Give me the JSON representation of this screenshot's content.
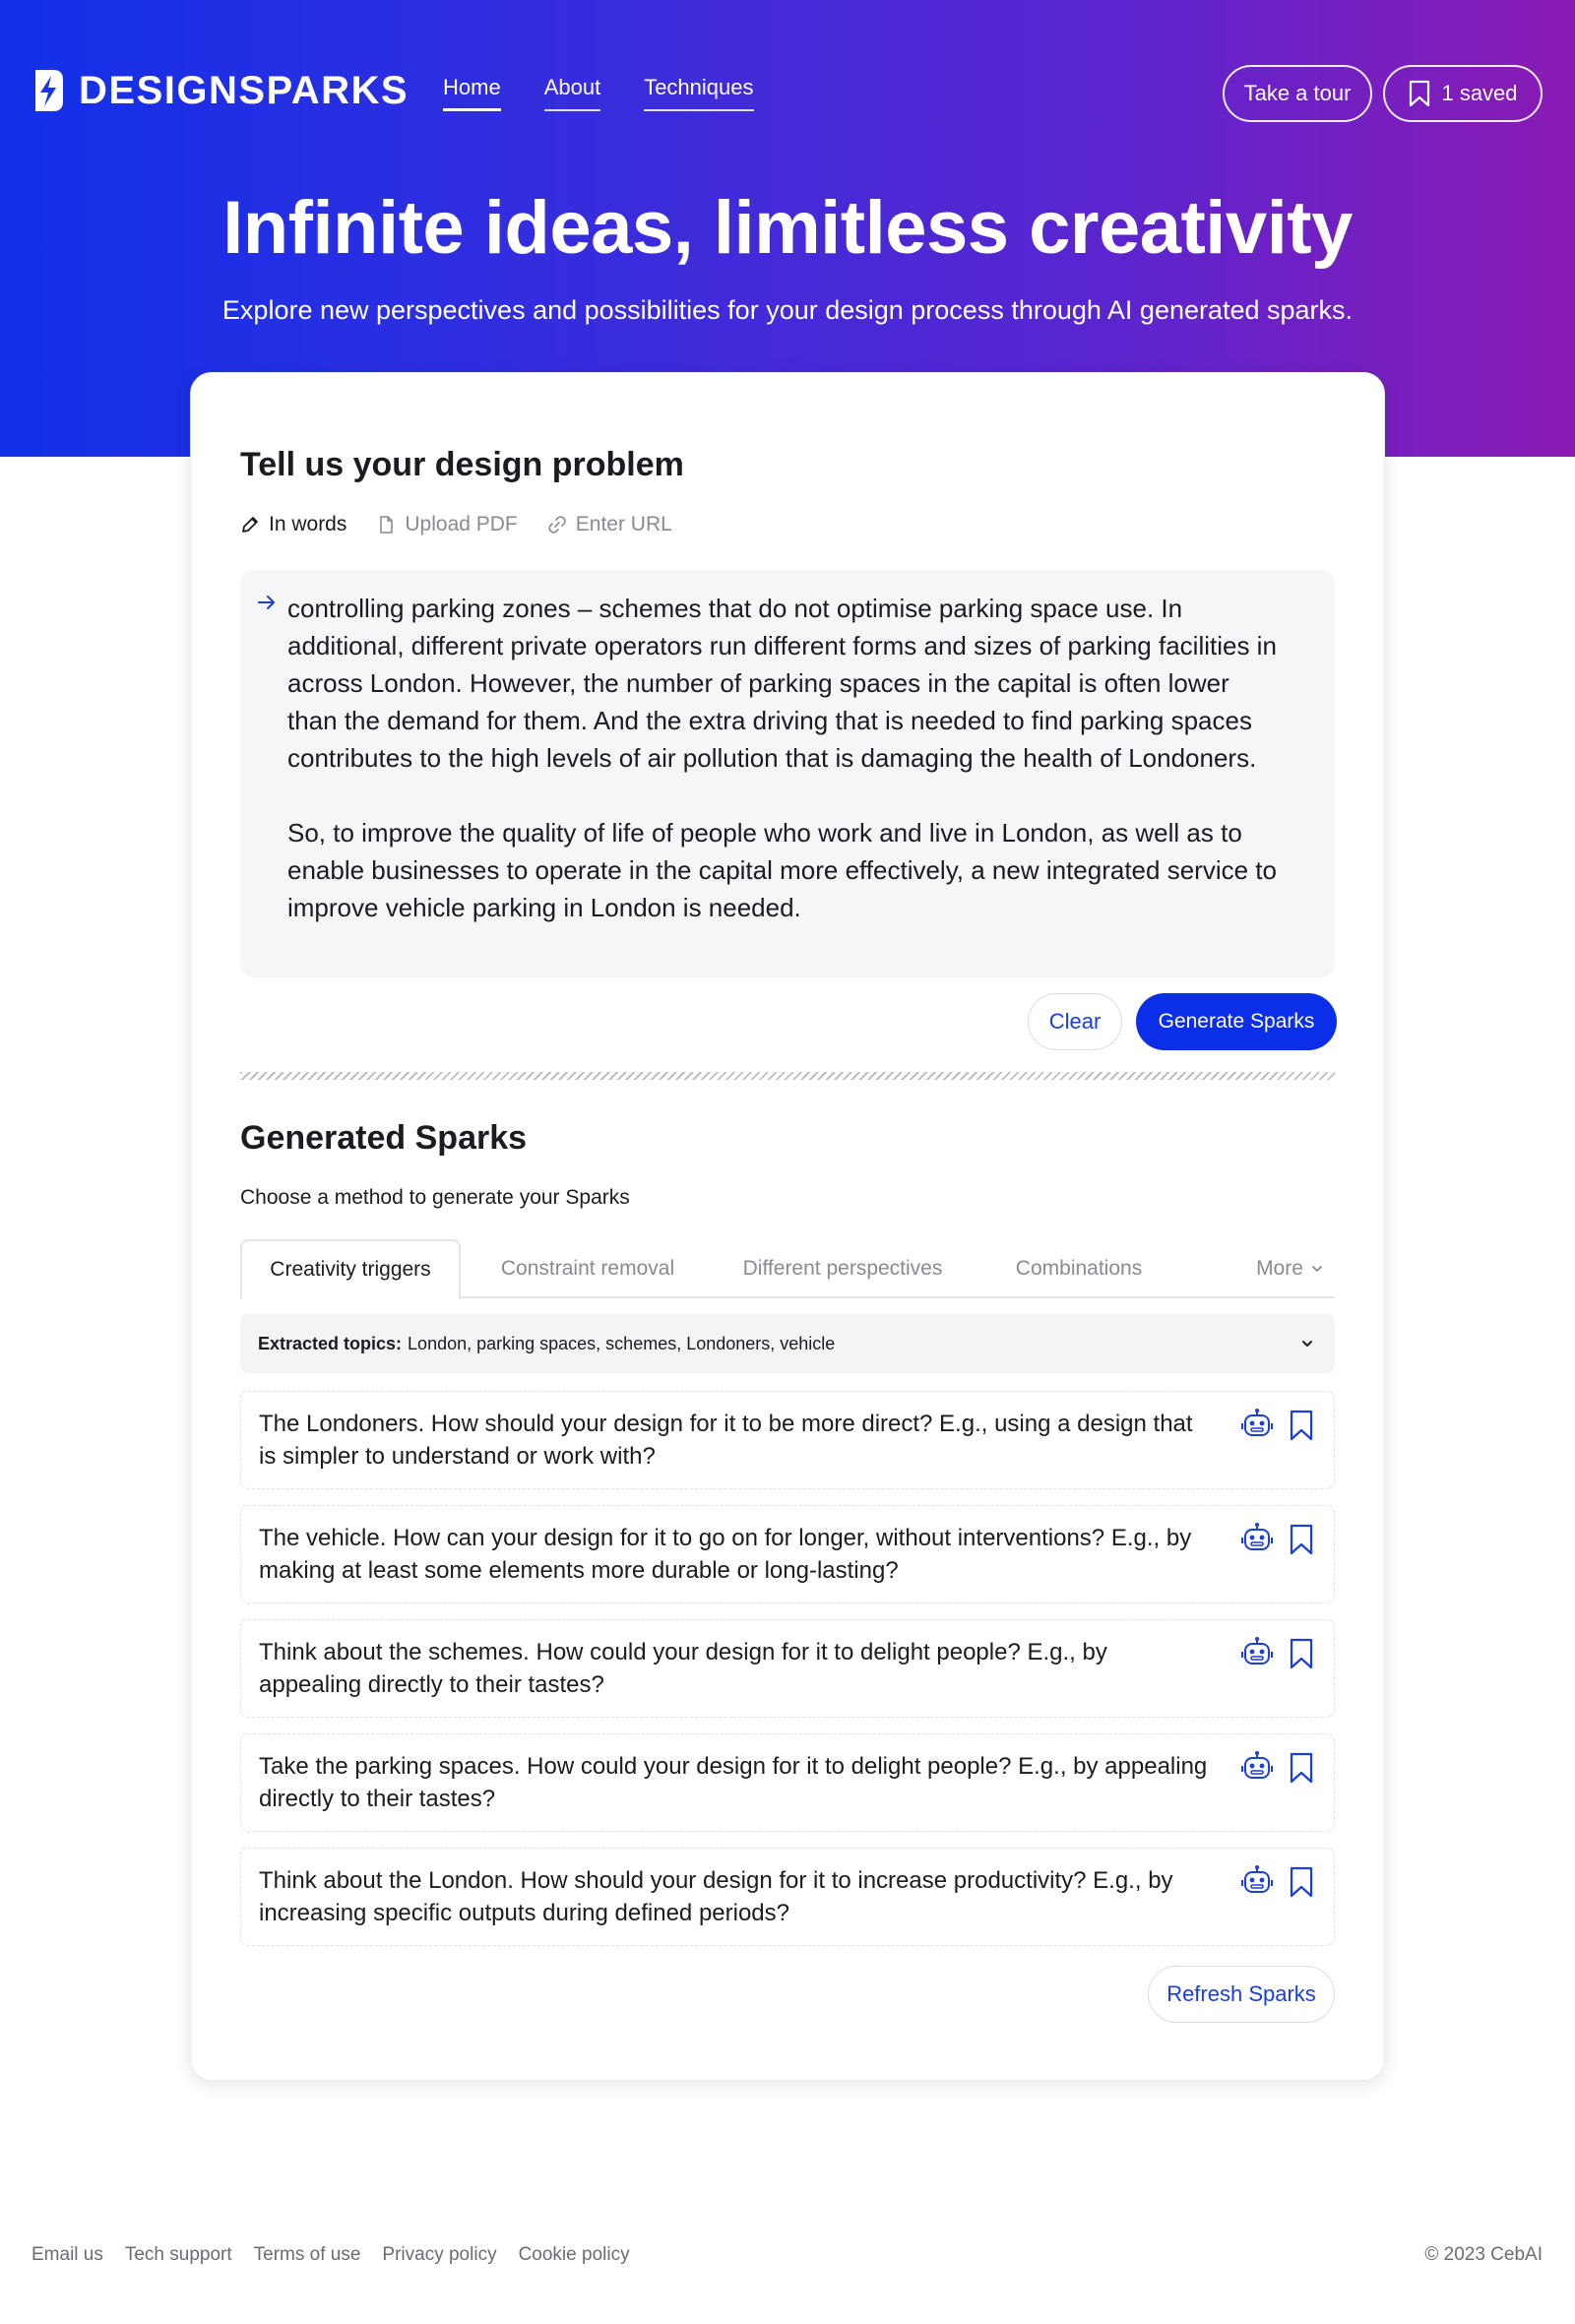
{
  "brand": {
    "name": "DESIGNSPARKS"
  },
  "nav": {
    "items": [
      {
        "label": "Home",
        "active": true
      },
      {
        "label": "About",
        "active": false
      },
      {
        "label": "Techniques",
        "active": false
      }
    ]
  },
  "header_actions": {
    "tour_label": "Take a tour",
    "saved_label": "1 saved"
  },
  "hero": {
    "title": "Infinite ideas, limitless creativity",
    "subtitle": "Explore new perspectives and possibilities for your design process through AI generated sparks."
  },
  "problem": {
    "title": "Tell us your design problem",
    "modes": [
      {
        "label": "In words",
        "icon": "pencil-icon",
        "active": true
      },
      {
        "label": "Upload PDF",
        "icon": "document-icon",
        "active": false
      },
      {
        "label": "Enter URL",
        "icon": "link-icon",
        "active": false
      }
    ],
    "text": "controlling parking zones – schemes that do not optimise parking space use. In additional, different private operators run different forms and sizes of parking facilities in across London. However, the number of parking spaces in the capital is often lower than the demand for them. And the extra driving that is needed to find parking spaces contributes to the high levels of air pollution that is damaging the health of Londoners.\n\nSo, to improve the quality of life of people who work and live in London, as well as to enable businesses to operate in the capital more effectively, a new integrated service to improve vehicle parking in London is needed.",
    "clear_label": "Clear",
    "generate_label": "Generate Sparks"
  },
  "sparks": {
    "title": "Generated Sparks",
    "choose_label": "Choose a method to generate your Sparks",
    "tabs": [
      {
        "label": "Creativity triggers",
        "active": true
      },
      {
        "label": "Constraint removal",
        "active": false
      },
      {
        "label": "Different perspectives",
        "active": false
      },
      {
        "label": "Combinations",
        "active": false
      }
    ],
    "more_label": "More",
    "topics_label": "Extracted topics:",
    "topics_value": "London, parking spaces, schemes, Londoners, vehicle",
    "items": [
      {
        "text": "The Londoners. How should your design for it to be more direct? E.g., using a design that is simpler to understand or work with?"
      },
      {
        "text": "The vehicle. How can your design for it to go on for longer, without interventions? E.g., by making at least some elements more durable or long-lasting?"
      },
      {
        "text": "Think about the schemes. How could your design for it to delight people? E.g., by appealing directly to their tastes?"
      },
      {
        "text": "Take the parking spaces. How could your design for it to delight people? E.g., by appealing directly to their tastes?"
      },
      {
        "text": "Think about the London. How should your design for it to increase productivity? E.g., by increasing specific outputs during defined periods?"
      }
    ],
    "refresh_label": "Refresh Sparks"
  },
  "footer": {
    "links": [
      "Email us",
      "Tech support",
      "Terms of use",
      "Privacy policy",
      "Cookie policy"
    ],
    "copyright": "© 2023 CebAI"
  },
  "colors": {
    "primary": "#0b2fe8",
    "link_blue": "#1a3fe0",
    "gradient_start": "#1230e8",
    "gradient_end": "#8a1ab4"
  }
}
